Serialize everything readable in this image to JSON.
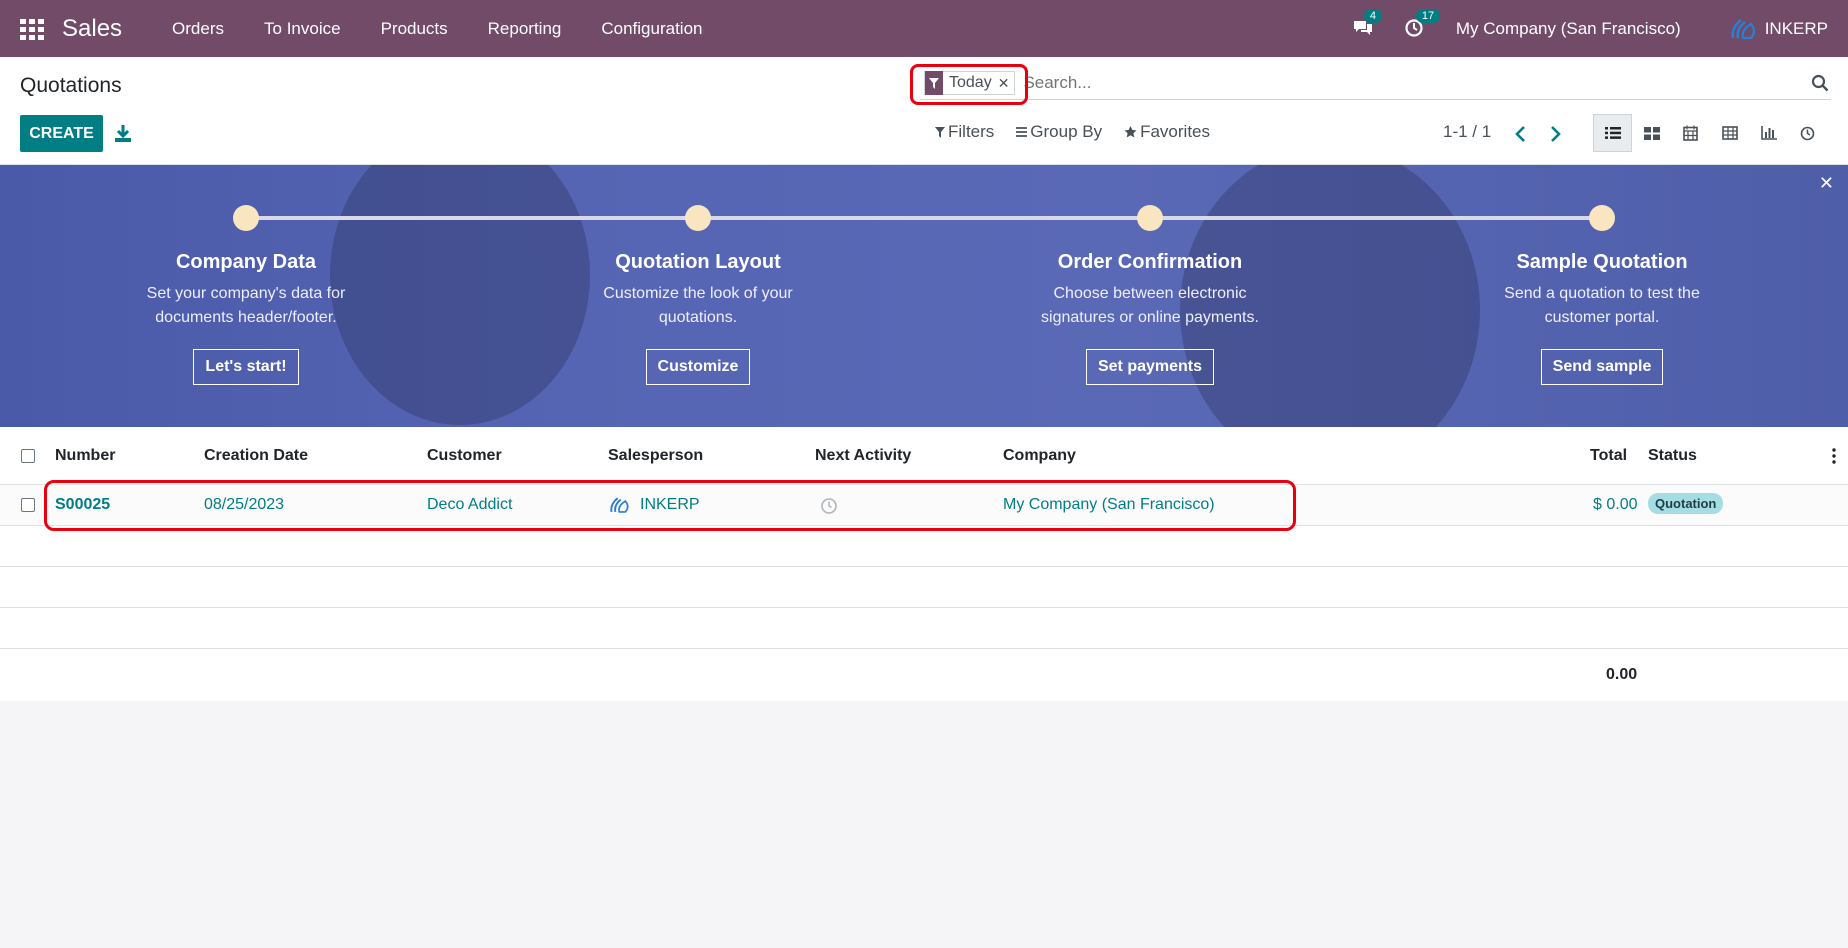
{
  "navbar": {
    "app_name": "Sales",
    "menu": [
      "Orders",
      "To Invoice",
      "Products",
      "Reporting",
      "Configuration"
    ],
    "messages_count": "4",
    "activities_count": "17",
    "company": "My Company (San Francisco)",
    "user": "INKERP"
  },
  "control": {
    "breadcrumb": "Quotations",
    "create_label": "CREATE",
    "facet_value": "Today",
    "search_placeholder": "Search...",
    "filters_label": "Filters",
    "groupby_label": "Group By",
    "favorites_label": "Favorites",
    "pager": "1-1 / 1"
  },
  "banner": {
    "steps": [
      {
        "title": "Company Data",
        "desc1": "Set your company's data for",
        "desc2": "documents header/footer.",
        "button": "Let's start!"
      },
      {
        "title": "Quotation Layout",
        "desc1": "Customize the look of your",
        "desc2": "quotations.",
        "button": "Customize"
      },
      {
        "title": "Order Confirmation",
        "desc1": "Choose between electronic",
        "desc2": "signatures or online payments.",
        "button": "Set payments"
      },
      {
        "title": "Sample Quotation",
        "desc1": "Send a quotation to test the",
        "desc2": "customer portal.",
        "button": "Send sample"
      }
    ]
  },
  "list": {
    "headers": {
      "number": "Number",
      "creation_date": "Creation Date",
      "customer": "Customer",
      "salesperson": "Salesperson",
      "next_activity": "Next Activity",
      "company": "Company",
      "total": "Total",
      "status": "Status"
    },
    "rows": [
      {
        "number": "S00025",
        "creation_date": "08/25/2023",
        "customer": "Deco Addict",
        "salesperson": "INKERP",
        "company": "My Company (San Francisco)",
        "total": "$ 0.00",
        "status": "Quotation"
      }
    ],
    "footer_total": "0.00"
  },
  "colors": {
    "navbar": "#714b67",
    "primary": "#017e84",
    "highlight": "#e8000f",
    "badge": "#a6dde5"
  }
}
